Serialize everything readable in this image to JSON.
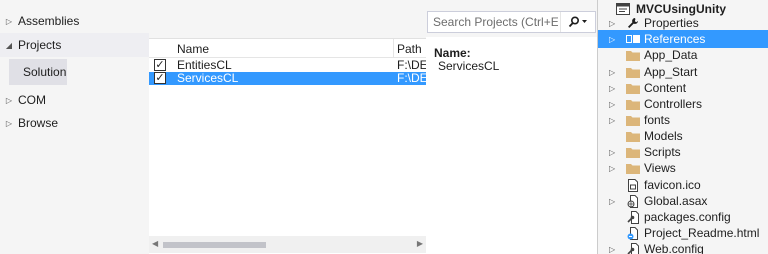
{
  "ref_manager": {
    "sidebar": {
      "items": [
        {
          "label": "Assemblies",
          "arrow": "▷",
          "expanded": false
        },
        {
          "label": "Projects",
          "arrow": "◢",
          "expanded": true
        },
        {
          "label": "COM",
          "arrow": "▷",
          "expanded": false
        },
        {
          "label": "Browse",
          "arrow": "▷",
          "expanded": false
        }
      ],
      "subitem": {
        "label": "Solution",
        "selected": true
      }
    },
    "list": {
      "headers": {
        "name": "Name",
        "path": "Path"
      },
      "rows": [
        {
          "checked": true,
          "check_glyph": "✓",
          "name": "EntitiesCL",
          "path": "F:\\DEM",
          "selected": false
        },
        {
          "checked": true,
          "check_glyph": "✓",
          "name": "ServicesCL",
          "path": "F:\\DEM",
          "selected": true
        }
      ],
      "scroll_left": "◀",
      "scroll_right": "▶"
    },
    "search": {
      "placeholder": "Search Projects (Ctrl+E)",
      "value": ""
    },
    "detail": {
      "name_label": "Name:",
      "name_value": "ServicesCL"
    }
  },
  "solution_explorer": {
    "project": {
      "label": "MVCUsingUnity",
      "icon": "project-icon"
    },
    "items": [
      {
        "label": "Properties",
        "icon": "wrench-icon",
        "expander": "▷"
      },
      {
        "label": "References",
        "icon": "references-icon",
        "expander": "▷",
        "selected": true
      },
      {
        "label": "App_Data",
        "icon": "folder-icon",
        "expander": ""
      },
      {
        "label": "App_Start",
        "icon": "folder-icon",
        "expander": "▷"
      },
      {
        "label": "Content",
        "icon": "folder-icon",
        "expander": "▷"
      },
      {
        "label": "Controllers",
        "icon": "folder-icon",
        "expander": "▷"
      },
      {
        "label": "fonts",
        "icon": "folder-icon",
        "expander": "▷"
      },
      {
        "label": "Models",
        "icon": "folder-icon",
        "expander": ""
      },
      {
        "label": "Scripts",
        "icon": "folder-icon",
        "expander": "▷"
      },
      {
        "label": "Views",
        "icon": "folder-icon",
        "expander": "▷"
      },
      {
        "label": "favicon.ico",
        "icon": "image-file-icon",
        "expander": ""
      },
      {
        "label": "Global.asax",
        "icon": "asax-file-icon",
        "expander": "▷"
      },
      {
        "label": "packages.config",
        "icon": "config-file-icon",
        "expander": ""
      },
      {
        "label": "Project_Readme.html",
        "icon": "html-file-icon",
        "expander": ""
      },
      {
        "label": "Web.config",
        "icon": "config-file-icon",
        "expander": "▷"
      }
    ]
  },
  "colors": {
    "selection": "#3399ff",
    "folder": "#dcb67a",
    "panel_bg": "#f5f5f5",
    "sidebar_active": "#eeeef2"
  }
}
